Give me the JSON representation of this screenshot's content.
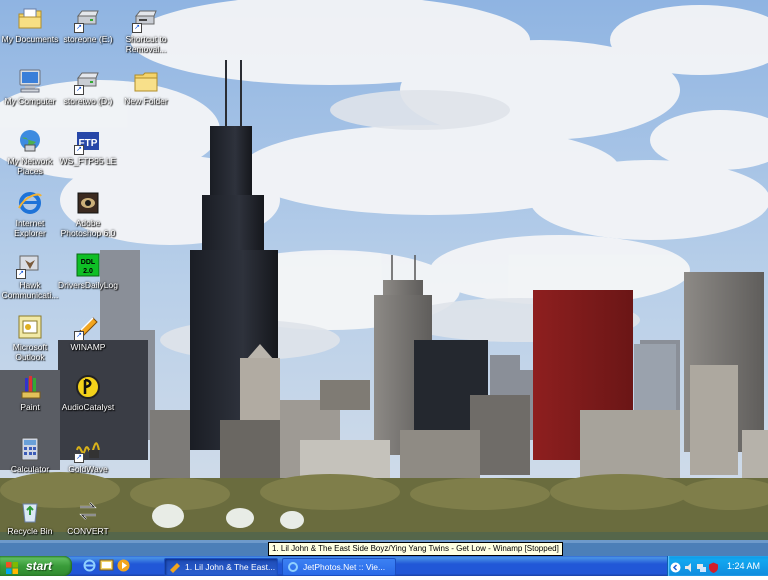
{
  "desktop": {
    "icons": [
      {
        "label": "My Documents",
        "icon": "my-documents-icon"
      },
      {
        "label": "storeone (E:)",
        "icon": "drive-icon"
      },
      {
        "label": "Shortcut to Removal...",
        "icon": "removable-drive-icon"
      },
      {
        "label": "My Computer",
        "icon": "my-computer-icon"
      },
      {
        "label": "storetwo (D:)",
        "icon": "drive-icon"
      },
      {
        "label": "New Folder",
        "icon": "folder-icon"
      },
      {
        "label": "My Network Places",
        "icon": "network-places-icon"
      },
      {
        "label": "WS_FTP95 LE",
        "icon": "ftp-icon"
      },
      {
        "label": "Internet Explorer",
        "icon": "internet-explorer-icon"
      },
      {
        "label": "Adobe Photoshop 6.0",
        "icon": "photoshop-icon"
      },
      {
        "label": "Hawk Communicati...",
        "icon": "hawk-icon"
      },
      {
        "label": "DriversDailyLog",
        "icon": "ddl-icon"
      },
      {
        "label": "Microsoft Outlook",
        "icon": "outlook-icon"
      },
      {
        "label": "WINAMP",
        "icon": "winamp-icon"
      },
      {
        "label": "Paint",
        "icon": "paint-icon"
      },
      {
        "label": "AudioCatalyst",
        "icon": "audiocatalyst-icon"
      },
      {
        "label": "Calculator",
        "icon": "calculator-icon"
      },
      {
        "label": "GoldWave",
        "icon": "goldwave-icon"
      },
      {
        "label": "Recycle Bin",
        "icon": "recycle-bin-icon"
      },
      {
        "label": "CONVERT",
        "icon": "convert-icon"
      }
    ],
    "icon_badges": {
      "ftp": "FTP",
      "ddl": "DDL 2.0"
    }
  },
  "tooltip": "1. Lil John & The East Side Boyz/Ying Yang Twins - Get Low - Winamp [Stopped]",
  "taskbar": {
    "start_label": "start",
    "tasks": [
      {
        "label": "1. Lil John & The East...",
        "icon": "winamp-icon",
        "active": true
      },
      {
        "label": "JetPhotos.Net :: Vie...",
        "icon": "internet-explorer-icon",
        "active": false
      }
    ],
    "clock": "1:24 AM"
  },
  "colors": {
    "taskbar_blue": "#2157d7",
    "start_green": "#3a9c3a",
    "tray_blue": "#0f8fe0"
  }
}
